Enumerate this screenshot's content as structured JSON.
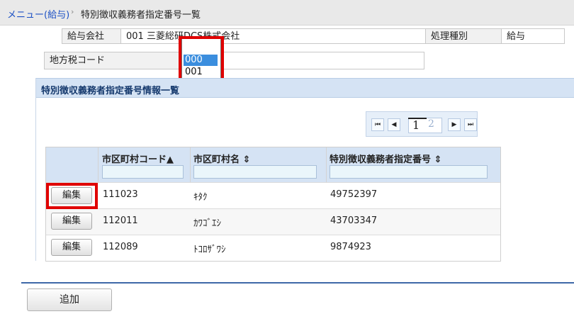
{
  "breadcrumb": {
    "link": "メニュー(給与)",
    "separator": "›",
    "current": "特別徴収義務者指定番号一覧"
  },
  "info": {
    "company_label": "給与会社",
    "company_value": "001 三菱総研DCS株式会社",
    "process_label": "処理種別",
    "process_value": "給与",
    "tax_code_label": "地方税コード"
  },
  "dropdown": {
    "options": [
      "000",
      "001"
    ],
    "selected": "000"
  },
  "section": {
    "title": "特別徴収義務者指定番号情報一覧"
  },
  "pager": {
    "first": "⏮",
    "prev": "◀",
    "next": "▶",
    "last": "⏭",
    "current_page": "1",
    "next_page": "2"
  },
  "table": {
    "headers": [
      "市区町村コード▲",
      "市区町村名 ⇕",
      "特別徴収義務者指定番号 ⇕"
    ],
    "rows": [
      {
        "edit": "編集",
        "code": "111023",
        "name": "ｷﾀｸ",
        "number": "49752397"
      },
      {
        "edit": "編集",
        "code": "112011",
        "name": "ｶﾜｺﾞｴｼ",
        "number": "43703347"
      },
      {
        "edit": "編集",
        "code": "112089",
        "name": "ﾄｺﾛｻﾞﾜｼ",
        "number": "9874923"
      }
    ]
  },
  "footer": {
    "add_label": "追加"
  },
  "colors": {
    "highlight": "#e00000",
    "header_bg": "#d5e3f4",
    "link": "#1a4fc4",
    "selected_option": "#3b8ede"
  }
}
